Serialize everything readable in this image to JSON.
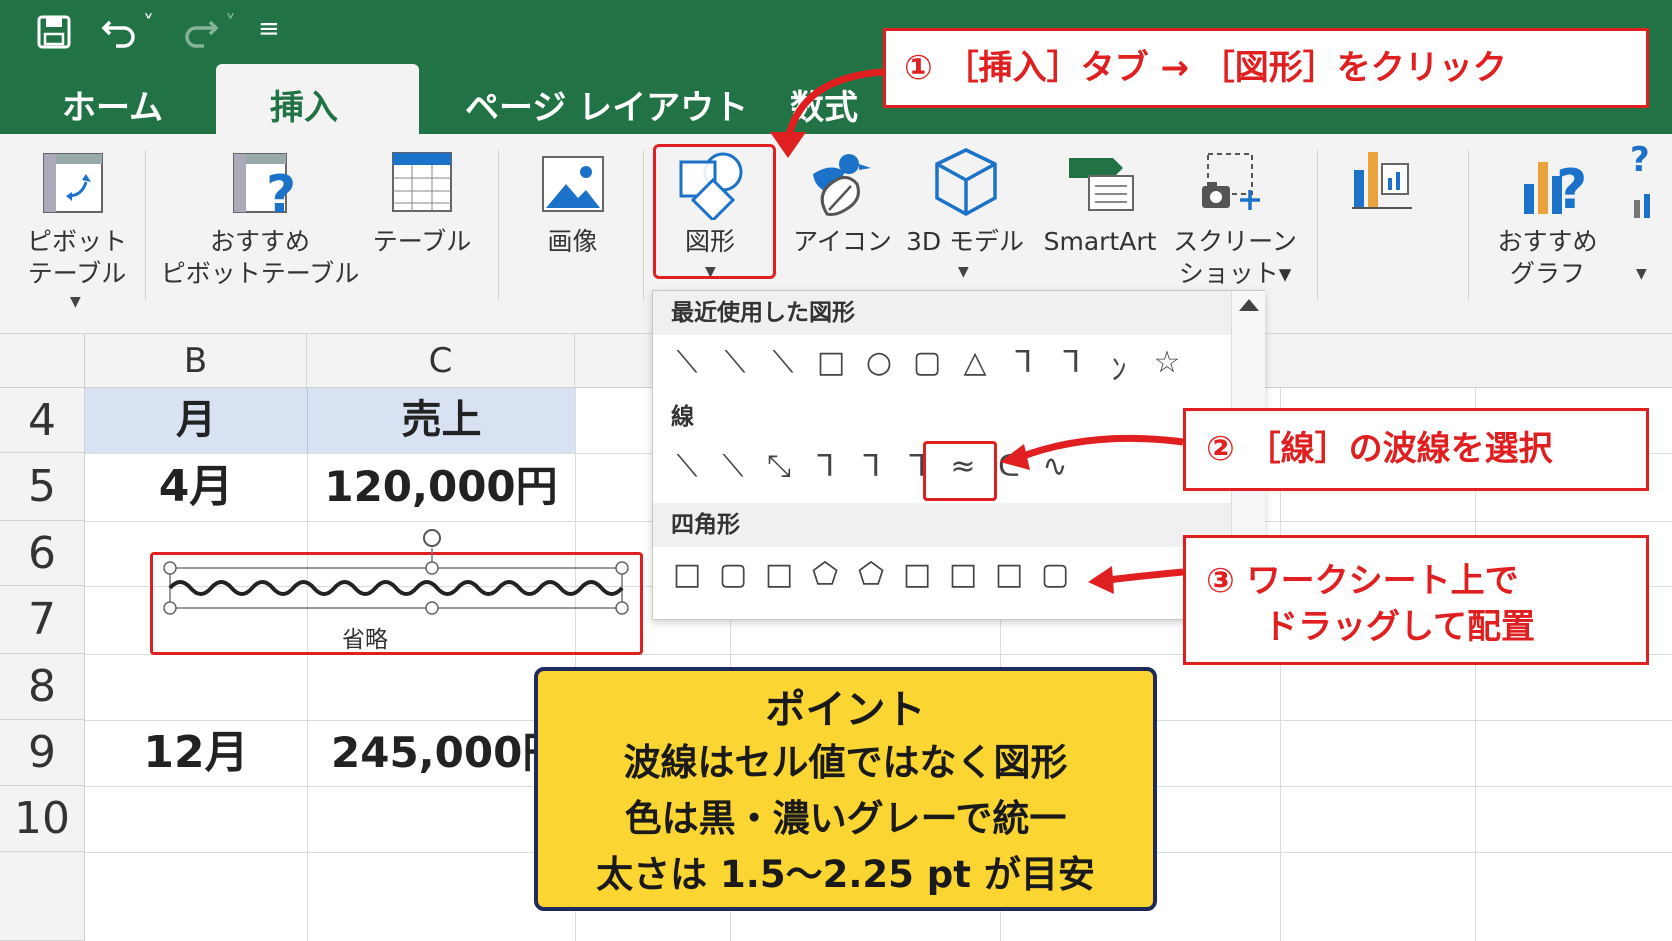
{
  "qat": {
    "undo_dropdown": "˅",
    "redo_dropdown": "˅",
    "customize": "≡"
  },
  "tabs": {
    "home": "ホーム",
    "insert": "挿入",
    "page_layout": "ページ レイアウト",
    "formulas": "数式"
  },
  "ribbon": {
    "pivot_table": [
      "ピボット",
      "テーブル"
    ],
    "recommended_pivot": [
      "おすすめ",
      "ピボットテーブル"
    ],
    "table": "テーブル",
    "picture": "画像",
    "shapes": "図形",
    "icons": "アイコン",
    "model_3d": "3D モデル",
    "smartart": "SmartArt",
    "screenshot": [
      "スクリーン",
      "ショット▾"
    ],
    "recommended_charts": [
      "おすすめ",
      "グラフ"
    ],
    "help": "?"
  },
  "columns": [
    "B",
    "C"
  ],
  "rows": [
    "4",
    "5",
    "6",
    "7",
    "8",
    "9",
    "10"
  ],
  "cells": {
    "b4": "月",
    "c4": "売上",
    "b5": "4月",
    "c5": "120,000円",
    "b9": "12月",
    "c9": "245,000円"
  },
  "wavy_shape_label": "省略",
  "shape_menu": {
    "recent_header": "最近使用した図形",
    "recent_glyphs": [
      "⟍",
      "⟍",
      "⟍",
      "□",
      "○",
      "▢",
      "△",
      "ᒣ",
      "ᒣ",
      "ﾝ",
      "☆"
    ],
    "lines_header": "線",
    "line_glyphs": [
      "⟍",
      "⟍",
      "⤡",
      "ᒣ",
      "ᒣ",
      "ᒣ",
      "≈",
      "ᑕ",
      "∿"
    ],
    "rect_header": "四角形",
    "rect_glyphs": [
      "□",
      "▢",
      "□",
      "⬠",
      "⬠",
      "□",
      "□",
      "□",
      "▢"
    ]
  },
  "callouts": {
    "step1": "① ［挿入］タブ → ［図形］をクリック",
    "step2": "② ［線］の波線を選択",
    "step3_line1": "③ ワークシート上で",
    "step3_line2": "ドラッグして配置"
  },
  "point": {
    "title": "ポイント",
    "line1": "波線はセル値ではなく図形",
    "line2": "色は黒・濃いグレーで統一",
    "line3": "太さは 1.5〜2.25 pt が目安"
  },
  "colors": {
    "excel_green": "#217346",
    "callout_red": "#e02020",
    "point_yellow": "#fbd531",
    "point_border": "#1e2a5a",
    "header_blue": "#d9e2f3"
  }
}
